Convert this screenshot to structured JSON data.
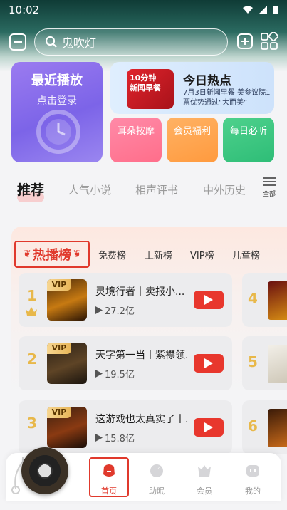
{
  "status_bar": {
    "time": "10:02"
  },
  "search": {
    "query": "鬼吹灯"
  },
  "recent": {
    "title": "最近播放",
    "subtitle": "点击登录"
  },
  "hot": {
    "title": "今日热点",
    "description": "7月3日新闻早餐|美参议院1票优势通过“大而美”",
    "thumb_label_1": "10分钟",
    "thumb_label_2": "新闻早餐"
  },
  "mini_cards": [
    "耳朵按摩",
    "会员福利",
    "每日必听"
  ],
  "tabs": [
    "推荐",
    "人气小说",
    "相声评书",
    "中外历史"
  ],
  "all_label": "全部",
  "rank_tabs": [
    "热播榜",
    "免费榜",
    "上新榜",
    "VIP榜",
    "儿童榜"
  ],
  "rank_rows": [
    {
      "rank": "1",
      "title": "灵境行者丨卖报小...",
      "plays": "27.2亿",
      "badge": "VIP"
    },
    {
      "rank": "2",
      "title": "天字第一当丨紫襟领...",
      "plays": "19.5亿",
      "badge": "VIP"
    },
    {
      "rank": "3",
      "title": "这游戏也太真实了丨...",
      "plays": "15.8亿",
      "badge": "VIP"
    }
  ],
  "side_ranks": [
    "4",
    "5",
    "6"
  ],
  "bottom_nav": [
    "首页",
    "助眠",
    "会员",
    "我的"
  ],
  "colors": {
    "accent": "#e0392c",
    "gold": "#e8b84a",
    "header": "#0f3b36"
  }
}
